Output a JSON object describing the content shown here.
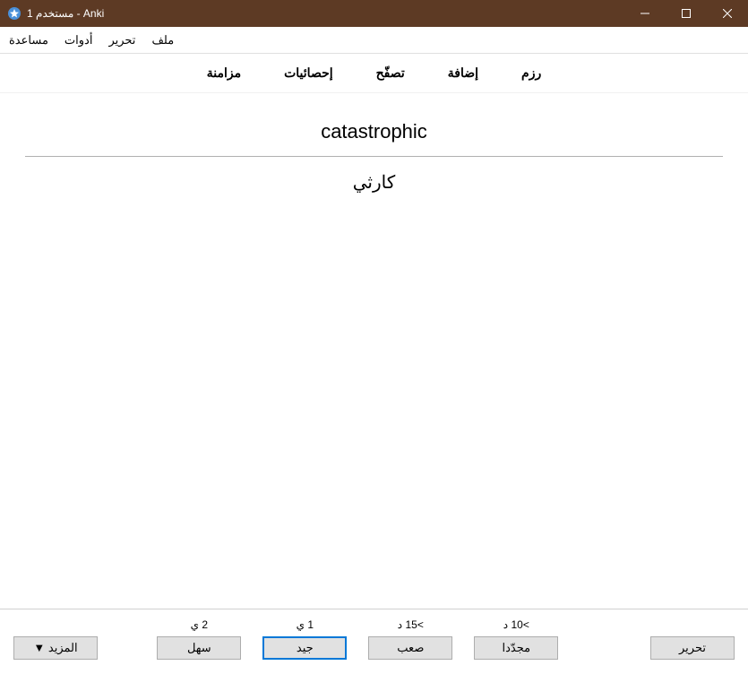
{
  "window": {
    "title": "مستخدم 1 - Anki"
  },
  "menubar": {
    "file": "ملف",
    "edit": "تحرير",
    "tools": "أدوات",
    "help": "مساعدة"
  },
  "toolbar": {
    "decks": "رزم",
    "add": "إضافة",
    "browse": "تصفّح",
    "stats": "إحصائيات",
    "sync": "مزامنة"
  },
  "card": {
    "front": "catastrophic",
    "back": "كارثي"
  },
  "bottom": {
    "edit_label": "تحرير",
    "more_label": "المزيد ▼",
    "answers": [
      {
        "interval": ">10 د",
        "label": "مجدّدا"
      },
      {
        "interval": ">15 د",
        "label": "صعب"
      },
      {
        "interval": "1 ي",
        "label": "جيد"
      },
      {
        "interval": "2 ي",
        "label": "سهل"
      }
    ]
  }
}
